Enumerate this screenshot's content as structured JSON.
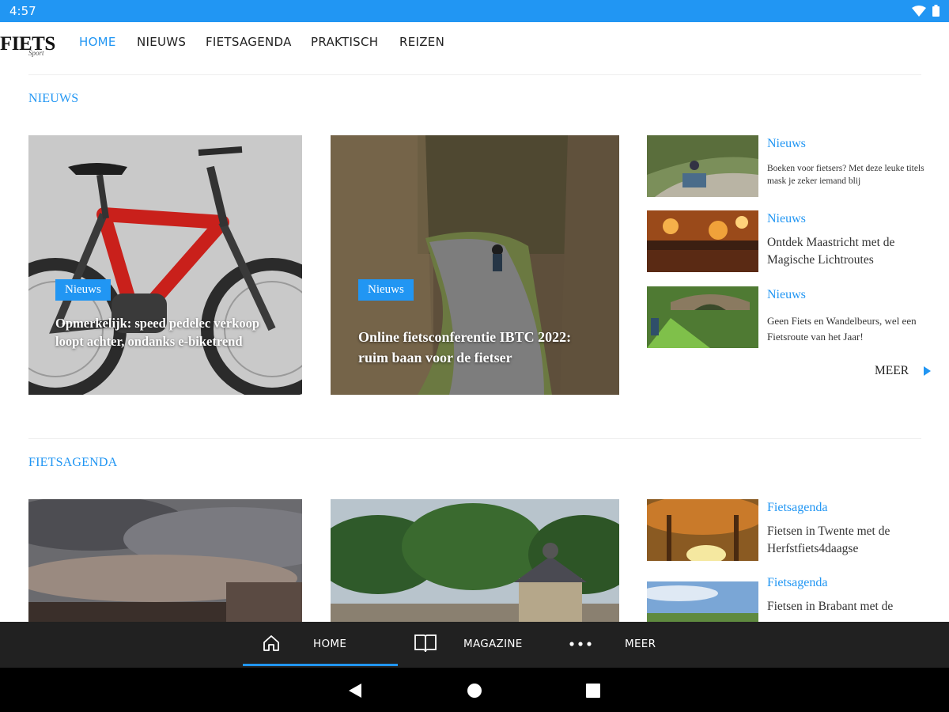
{
  "status_bar": {
    "time": "4:57",
    "icons": [
      "wifi-icon",
      "battery-icon"
    ]
  },
  "brand": {
    "logo_text": "FIETS",
    "logo_sub": "Sport"
  },
  "nav": {
    "items": [
      {
        "label": "HOME",
        "active": true
      },
      {
        "label": "NIEUWS"
      },
      {
        "label": "FIETSAGENDA"
      },
      {
        "label": "PRAKTISCH"
      },
      {
        "label": "REIZEN"
      }
    ]
  },
  "colors": {
    "accent": "#2196f3",
    "tabbar": "#212121",
    "statusbar": "#2196f3"
  },
  "news": {
    "title": "NIEUWS",
    "featured": [
      {
        "tag": "Nieuws",
        "title": "Opmerkelijk: speed pedelec verkoop loopt achter, ondanks e-biketrend"
      },
      {
        "tag": "Nieuws",
        "title": "Online fietsconferentie IBTC 2022: ruim baan voor de fietser"
      }
    ],
    "side": [
      {
        "category": "Nieuws",
        "title": "Boeken voor fietsers? Met deze leuke titels mask je zeker iemand blij"
      },
      {
        "category": "Nieuws",
        "title": "Ontdek Maastricht met de Magische Lichtroutes"
      },
      {
        "category": "Nieuws",
        "title": "Geen Fiets en Wandelbeurs, wel een Fietsroute van het Jaar!"
      }
    ],
    "more_label": "MEER"
  },
  "agenda": {
    "title": "FIETSAGENDA",
    "side": [
      {
        "category": "Fietsagenda",
        "title": "Fietsen in Twente met de Herfstfiets4daagse"
      },
      {
        "category": "Fietsagenda",
        "title": "Fietsen in Brabant met de"
      }
    ]
  },
  "tabbar": {
    "tabs": [
      {
        "label": "HOME",
        "icon": "home-icon",
        "active": true
      },
      {
        "label": "MAGAZINE",
        "icon": "book-icon"
      },
      {
        "label": "MEER",
        "icon": "more-dots-icon"
      }
    ]
  },
  "system_nav": [
    "back-icon",
    "home-circle-icon",
    "recents-icon"
  ]
}
